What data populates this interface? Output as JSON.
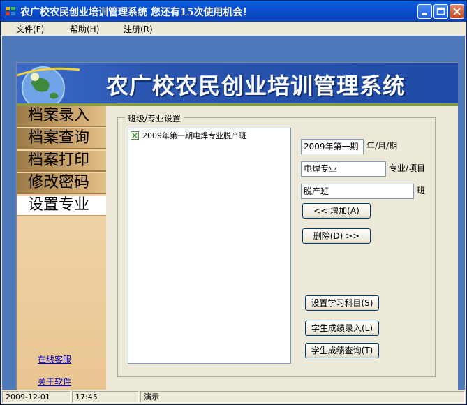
{
  "window": {
    "title": "农广校农民创业培训管理系统    您还有15次使用机会！"
  },
  "menu": {
    "items": [
      {
        "label": "文件(F)"
      },
      {
        "label": "帮助(H)"
      },
      {
        "label": "注册(R)"
      }
    ]
  },
  "banner": {
    "title": "农广校农民创业培训管理系统"
  },
  "sidebar": {
    "nav": [
      {
        "label": "档案录入"
      },
      {
        "label": "档案查询"
      },
      {
        "label": "档案打印"
      },
      {
        "label": "修改密码"
      },
      {
        "label": "设置专业",
        "active": true
      }
    ],
    "links": {
      "online_service": "在线客服",
      "about": "关于软件"
    }
  },
  "settings": {
    "group_title": "班级/专业设置",
    "list_items": [
      "2009年第一期电焊专业脱产班"
    ],
    "year_value": "2009年第一期",
    "year_label": "年/月/期",
    "major_value": "电焊专业",
    "major_label": "专业/项目",
    "class_value": "脱产班",
    "class_label": "班",
    "add_button": "<< 增加(A)",
    "delete_button": "删除(D) >>",
    "subjects_button": "设置学习科目(S)",
    "score_entry_button": "学生成绩录入(L)",
    "score_query_button": "学生成绩查询(T)"
  },
  "status": {
    "date": "2009-12-01",
    "time": "17:45",
    "mode": "演示"
  },
  "colors": {
    "titlebar": "#0a4fcf",
    "banner": "#2a56b0",
    "sidebar": "#e9c591",
    "link": "#0000cc"
  }
}
